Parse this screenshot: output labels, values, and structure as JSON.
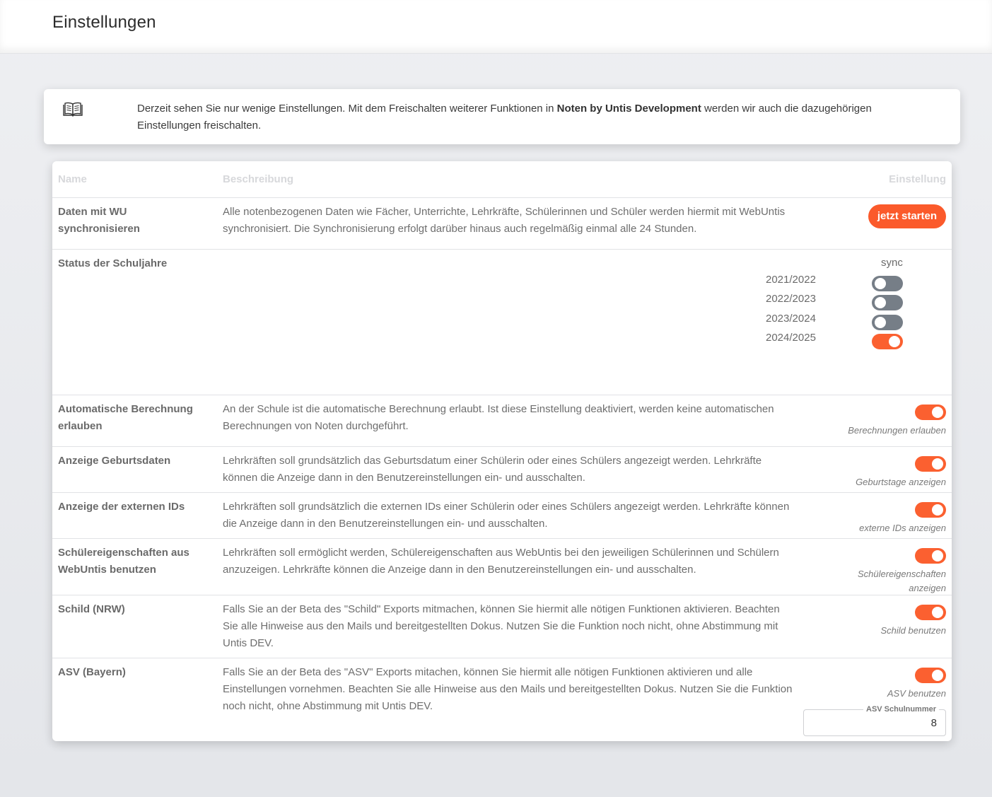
{
  "page": {
    "title": "Einstellungen"
  },
  "info": {
    "text_before": "Derzeit sehen Sie nur wenige Einstellungen. Mit dem Freischalten weiterer Funktionen in ",
    "text_bold": "Noten by Untis Development",
    "text_after": " werden wir auch die dazugehörigen Einstellungen freischalten.",
    "icon": "book-icon"
  },
  "table": {
    "headers": {
      "name": "Name",
      "description": "Beschreibung",
      "setting": "Einstellung"
    },
    "sync": {
      "name": "Daten mit WU synchronisieren",
      "description": "Alle notenbezogenen Daten wie Fächer, Unterrichte, Lehrkräfte, Schülerinnen und Schüler werden hiermit mit WebUntis synchronisiert. Die Synchronisierung erfolgt darüber hinaus auch regelmäßig einmal alle 24 Stunden.",
      "button_label": "jetzt starten"
    },
    "school_years": {
      "name": "Status der Schuljahre",
      "sync_label": "sync",
      "years": [
        {
          "label": "2021/2022",
          "sync": false
        },
        {
          "label": "2022/2023",
          "sync": false
        },
        {
          "label": "2023/2024",
          "sync": false
        },
        {
          "label": "2024/2025",
          "sync": true
        }
      ]
    },
    "auto_calc": {
      "name": "Automatische Berechnung erlauben",
      "description": "An der Schule ist die automatische Berechnung erlaubt. Ist diese Einstellung deaktiviert, werden keine automatischen Berechnungen von Noten durchgeführt.",
      "toggle_label": "Berechnungen erlauben",
      "enabled": true
    },
    "birthdates": {
      "name": "Anzeige Geburtsdaten",
      "description": "Lehrkräften soll grundsätzlich das Geburtsdatum einer Schülerin oder eines Schülers angezeigt werden. Lehrkräfte können die Anzeige dann in den Benutzereinstellungen ein- und ausschalten.",
      "toggle_label": "Geburtstage anzeigen",
      "enabled": true
    },
    "external_ids": {
      "name": "Anzeige der externen IDs",
      "description": "Lehrkräften soll grundsätzlich die externen IDs einer Schülerin oder eines Schülers angezeigt werden. Lehrkräfte können die Anzeige dann in den Benutzereinstellungen ein- und ausschalten.",
      "toggle_label": "externe IDs anzeigen",
      "enabled": true
    },
    "student_props": {
      "name": "Schülereigenschaften aus WebUntis benutzen",
      "description": "Lehrkräften soll ermöglicht werden, Schülereigenschaften aus WebUntis bei den jeweiligen Schülerinnen und Schülern anzuzeigen. Lehrkräfte können die Anzeige dann in den Benutzereinstellungen ein- und ausschalten.",
      "toggle_label": "Schülereigenschaften anzeigen",
      "enabled": true
    },
    "schild": {
      "name": "Schild (NRW)",
      "description": "Falls Sie an der Beta des \"Schild\" Exports mitmachen, können Sie hiermit alle nötigen Funktionen aktivieren. Beachten Sie alle Hinweise aus den Mails und bereitgestellten Dokus. Nutzen Sie die Funktion noch nicht, ohne Abstimmung mit Untis DEV.",
      "toggle_label": "Schild benutzen",
      "enabled": true
    },
    "asv": {
      "name": "ASV (Bayern)",
      "description": "Falls Sie an der Beta des \"ASV\" Exports mitachen, können Sie hiermit alle nötigen Funktionen aktivieren und alle Einstellungen vornehmen. Beachten Sie alle Hinweise aus den Mails und bereitgestellten Dokus. Nutzen Sie die Funktion noch nicht, ohne Abstimmung mit Untis DEV.",
      "toggle_label": "ASV benutzen",
      "enabled": true,
      "field_label": "ASV Schulnummer",
      "field_value": "8"
    }
  },
  "colors": {
    "accent": "#fb6030",
    "toggle_off": "#767e87"
  }
}
